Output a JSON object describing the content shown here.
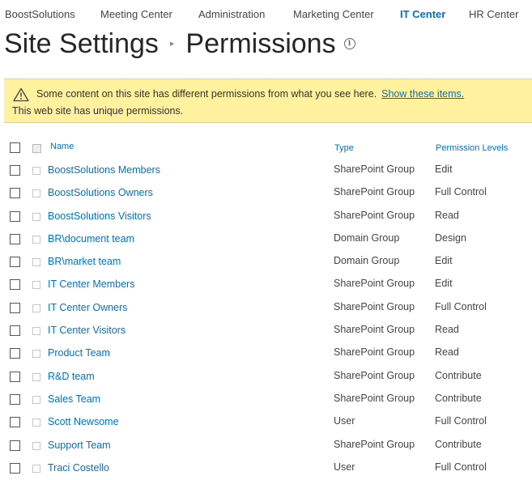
{
  "topnav": {
    "items": [
      {
        "label": "BoostSolutions",
        "active": false
      },
      {
        "label": "Meeting Center",
        "active": false
      },
      {
        "label": "Administration",
        "active": false
      },
      {
        "label": "Marketing Center",
        "active": false
      },
      {
        "label": "IT Center",
        "active": true
      },
      {
        "label": "HR Center",
        "active": false
      }
    ]
  },
  "page": {
    "title_parent": "Site Settings",
    "title_current": "Permissions",
    "separator_icon": "triangle-right-icon",
    "info_icon": "info-icon"
  },
  "notice": {
    "icon": "warning-icon",
    "message": "Some content on this site has different permissions from what you see here.",
    "link_label": "Show these items.",
    "sub_message": "This web site has unique permissions."
  },
  "table": {
    "columns": {
      "name": "Name",
      "type": "Type",
      "permission": "Permission Levels"
    },
    "rows": [
      {
        "name": "BoostSolutions Members",
        "type": "SharePoint Group",
        "permission": "Edit"
      },
      {
        "name": "BoostSolutions Owners",
        "type": "SharePoint Group",
        "permission": "Full Control"
      },
      {
        "name": "BoostSolutions Visitors",
        "type": "SharePoint Group",
        "permission": "Read"
      },
      {
        "name": "BR\\document team",
        "type": "Domain Group",
        "permission": "Design"
      },
      {
        "name": "BR\\market team",
        "type": "Domain Group",
        "permission": "Edit"
      },
      {
        "name": "IT Center Members",
        "type": "SharePoint Group",
        "permission": "Edit"
      },
      {
        "name": "IT Center Owners",
        "type": "SharePoint Group",
        "permission": "Full Control"
      },
      {
        "name": "IT Center Visitors",
        "type": "SharePoint Group",
        "permission": "Read"
      },
      {
        "name": "Product Team",
        "type": "SharePoint Group",
        "permission": "Read"
      },
      {
        "name": "R&D team",
        "type": "SharePoint Group",
        "permission": "Contribute"
      },
      {
        "name": "Sales Team",
        "type": "SharePoint Group",
        "permission": "Contribute"
      },
      {
        "name": "Scott Newsome",
        "type": "User",
        "permission": "Full Control"
      },
      {
        "name": "Support Team",
        "type": "SharePoint Group",
        "permission": "Contribute"
      },
      {
        "name": "Traci Costello",
        "type": "User",
        "permission": "Full Control"
      }
    ]
  },
  "colors": {
    "accent": "#0072c6",
    "notice_bg": "#fff19d",
    "title": "#262626"
  }
}
